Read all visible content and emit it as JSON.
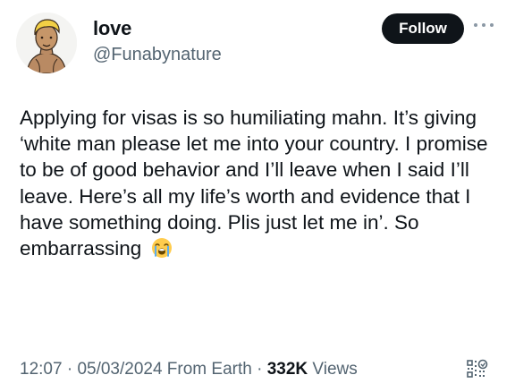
{
  "user": {
    "name": "love",
    "handle": "@Funabynature"
  },
  "follow_button": {
    "label": "Follow"
  },
  "tweet": {
    "text": "Applying for visas is so humiliating mahn. It’s giving ‘white man please let me into your country. I promise to be of good behavior and I’ll leave when I said I’ll leave. Here’s all my life’s worth and evidence that I have something doing. Plis just let me in’. So embarrassing",
    "emoji": "loudly-crying-face-icon"
  },
  "meta": {
    "time": "12:07",
    "sep1": " · ",
    "date": "05/03/2024",
    "source": " From Earth",
    "sep2": " · ",
    "views_count": "332K",
    "views_label": " Views"
  },
  "colors": {
    "text": "#0f1419",
    "secondary": "#536471",
    "button_bg": "#0f1419",
    "button_text": "#ffffff"
  }
}
